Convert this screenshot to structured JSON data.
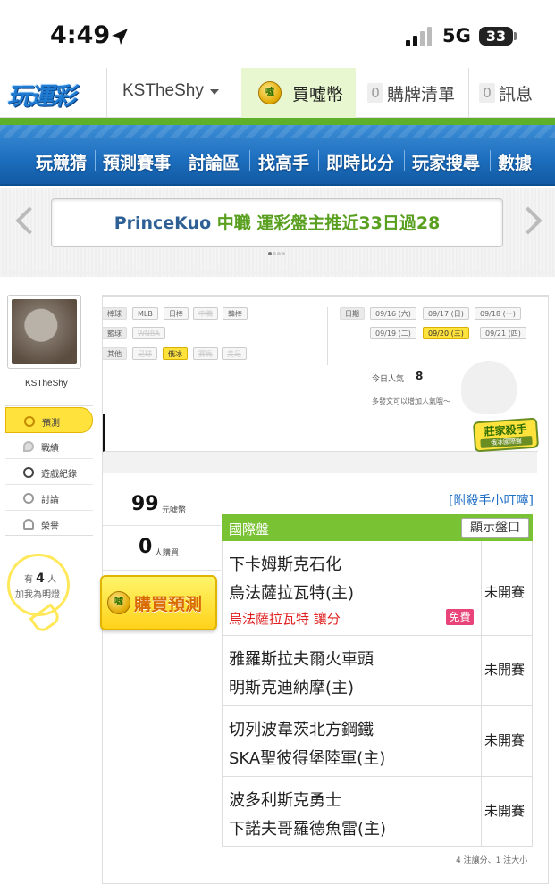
{
  "status_bar": {
    "time": "4:49",
    "network": "5G",
    "battery": "33"
  },
  "top_nav": {
    "logo": "玩運彩",
    "username": "KSTheShy",
    "buy_coins": "買噓幣",
    "coin_glyph": "噓",
    "cart_count": "0",
    "cart_label": "購牌清單",
    "msg_count": "0",
    "msg_label": "訊息"
  },
  "main_nav": [
    "玩競猜",
    "預測賽事",
    "討論區",
    "找高手",
    "即時比分",
    "玩家搜尋",
    "數據"
  ],
  "banner": {
    "name": "PrinceKuo",
    "league": "中職",
    "text": "運彩盤主推近33日過28"
  },
  "sidebar": {
    "username": "KSTheShy",
    "items": [
      {
        "label": "預測",
        "icon": "target-icon",
        "active": true
      },
      {
        "label": "戰績",
        "icon": "chat-icon"
      },
      {
        "label": "遊戲紀錄",
        "icon": "circle-icon"
      },
      {
        "label": "討論",
        "icon": "compass-icon"
      },
      {
        "label": "榮譽",
        "icon": "medal-icon"
      }
    ],
    "fans_prefix": "有",
    "fans_count": "4",
    "fans_suffix": "人",
    "fans_label": "加我為明燈"
  },
  "filters": {
    "baseball": {
      "label": "棒球",
      "tags": [
        "MLB",
        "日棒",
        "中職",
        "韓棒"
      ]
    },
    "basketball": {
      "label": "籃球",
      "tags": [
        "WNBA"
      ]
    },
    "other": {
      "label": "其他",
      "tags": [
        "足球",
        "俄冰",
        "賽馬",
        "美足"
      ]
    },
    "date_label": "日期",
    "dates": [
      "09/16 (六)",
      "09/17 (日)",
      "09/18 (一)",
      "09/19 (二)",
      "09/20 (三)",
      "09/21 (四)"
    ]
  },
  "popularity": {
    "label": "今日人氣",
    "value": "8",
    "hint": "多發文可以增加人氣哦～"
  },
  "badge": {
    "title": "莊家殺手",
    "subtitle": "俄冰國際盤"
  },
  "stats": {
    "coins_value": "99",
    "coins_unit": "元噓幣",
    "buyers_value": "0",
    "buyers_unit": "人購買"
  },
  "buy_button": "購買預測",
  "tip_link": "[附殺手小叮嚀]",
  "table": {
    "title": "國際盤",
    "show_button": "顯示盤口",
    "rows": [
      {
        "away": "下卡姆斯克石化",
        "home": "烏法薩拉瓦特(主)",
        "status": "未開賽",
        "pick": "烏法薩拉瓦特  讓分",
        "badge": "免費"
      },
      {
        "away": "雅羅斯拉夫爾火車頭",
        "home": "明斯克迪納摩(主)",
        "status": "未開賽"
      },
      {
        "away": "切列波韋茨北方鋼鐵",
        "home": "SKA聖彼得堡陸軍(主)",
        "status": "未開賽"
      },
      {
        "away": "波多利斯克勇士",
        "home": "下諾夫哥羅德魚雷(主)",
        "status": "未開賽"
      }
    ],
    "footer": "4 注讓分、1 注大小"
  }
}
